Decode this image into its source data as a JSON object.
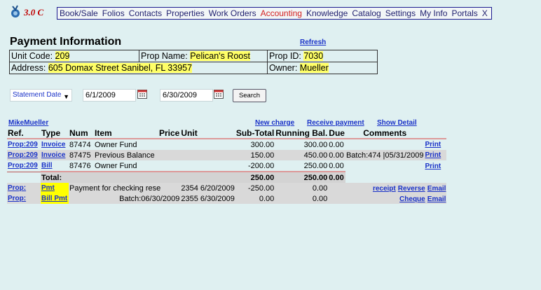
{
  "app": {
    "version": "3.0 C"
  },
  "menu": {
    "items": [
      "Book/Sale",
      "Folios",
      "Contacts",
      "Properties",
      "Work Orders",
      "Accounting",
      "Knowledge",
      "Catalog",
      "Settings",
      "My Info",
      "Portals"
    ],
    "active": "Accounting",
    "close": "X"
  },
  "page": {
    "title": "Payment Information",
    "refresh": "Refresh"
  },
  "info": {
    "unit_code_label": "Unit Code:",
    "unit_code": "209",
    "prop_name_label": "Prop Name:",
    "prop_name": "Pelican's Roost",
    "prop_id_label": "Prop ID:",
    "prop_id": "7030",
    "address_label": "Address:",
    "address": "605 Domax Street Sanibel, FL 33957",
    "owner_label": "Owner:",
    "owner": "Mueller"
  },
  "filter": {
    "select": "Statement Date",
    "start": "6/1/2009",
    "end": "6/30/2009",
    "search": "Search"
  },
  "links": {
    "owner": "MikeMueller",
    "new_charge": "New charge",
    "receive_payment": "Receive payment",
    "show_detail": "Show Detail"
  },
  "table": {
    "headers": {
      "ref": "Ref.",
      "type": "Type",
      "num": "Num",
      "item": "Item",
      "price": "Price",
      "unit": "Unit",
      "subtotal": "Sub-Total",
      "running": "Running Bal.",
      "due": "Due",
      "comments": "Comments"
    },
    "rows": [
      {
        "ref": "Prop:209",
        "type": "Invoice",
        "num": "87474",
        "item": "Owner Fund",
        "price": "",
        "unit": "",
        "subtotal": "300.00",
        "running": "300.00",
        "due": "0.00",
        "comments": "",
        "print": "Print"
      },
      {
        "ref": "Prop:209",
        "type": "Invoice",
        "num": "87475",
        "item": "Previous Balance",
        "price": "",
        "unit": "",
        "subtotal": "150.00",
        "running": "450.00",
        "due": "0.00",
        "comments": "Batch:474 |05/31/2009",
        "print": "Print"
      },
      {
        "ref": "Prop:209",
        "type": "Bill",
        "num": "87476",
        "item": "Owner Fund",
        "price": "",
        "unit": "",
        "subtotal": "-200.00",
        "running": "250.00",
        "due": "0.00",
        "comments": "",
        "print": "Print"
      }
    ],
    "total": {
      "label": "Total:",
      "subtotal": "250.00",
      "running": "250.00",
      "due": "0.00"
    },
    "payments": [
      {
        "ref": "Prop:",
        "type": "Pmt",
        "item": "Payment for checking rese",
        "price": "2354",
        "unit": "6/20/2009",
        "subtotal": "-250.00",
        "running": "0.00",
        "actions": [
          "receipt",
          "Reverse",
          "Email"
        ]
      },
      {
        "ref": "Prop:",
        "type": "Bill Pmt",
        "item": "Batch:06/30/2009",
        "price": "2355",
        "unit": "6/30/2009",
        "subtotal": "0.00",
        "running": "0.00",
        "actions": [
          "Cheque",
          "Email"
        ]
      }
    ]
  }
}
